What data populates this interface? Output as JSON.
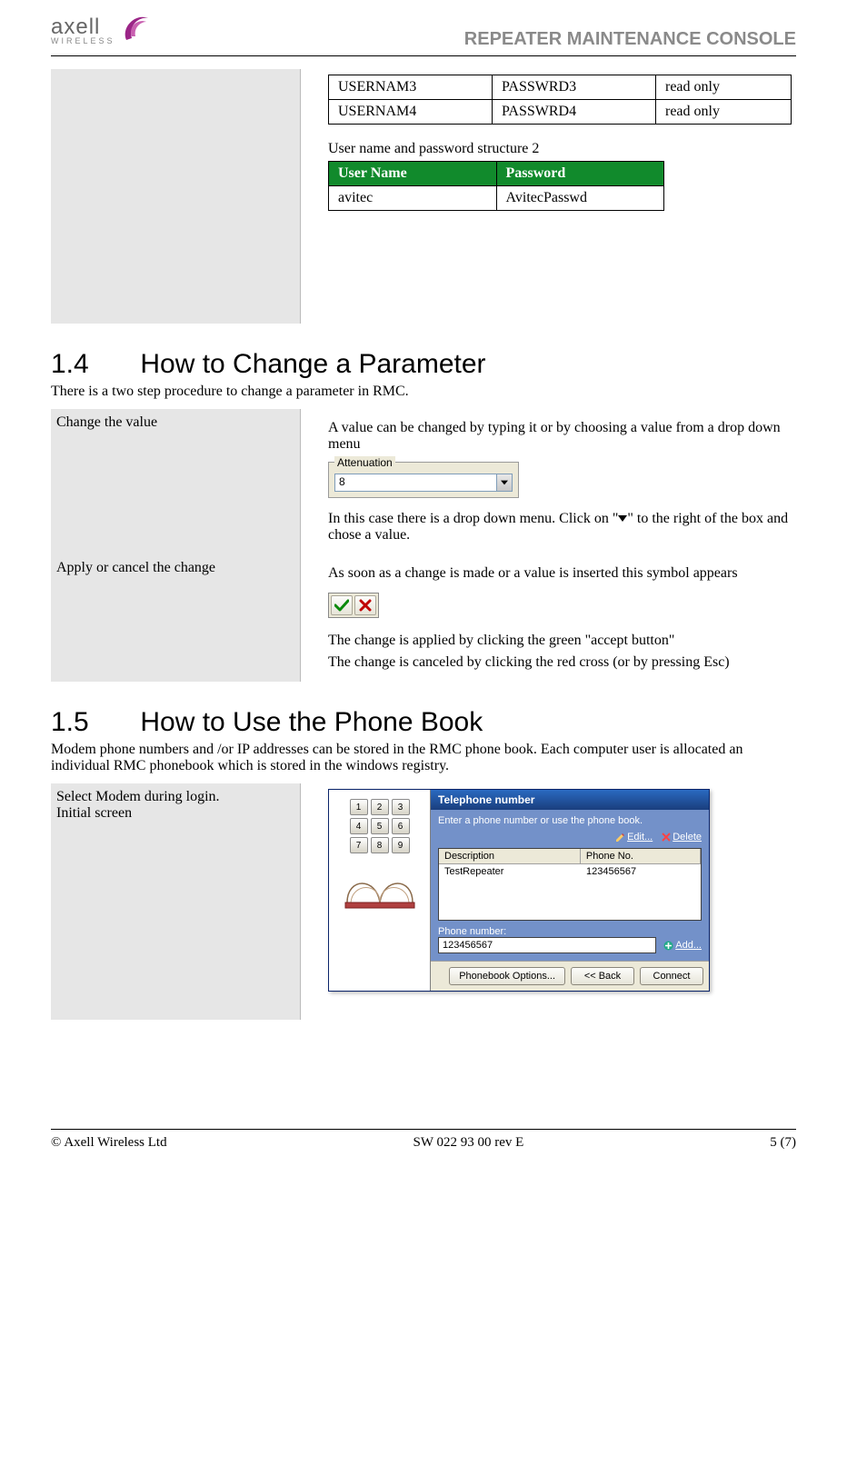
{
  "header": {
    "logo_main": "axell",
    "logo_sub": "WIRELESS",
    "title": "REPEATER MAINTENANCE CONSOLE"
  },
  "cred_table": {
    "rows": [
      {
        "user": "USERNAM3",
        "pass": "PASSWRD3",
        "perm": "read only"
      },
      {
        "user": "USERNAM4",
        "pass": "PASSWRD4",
        "perm": "read only"
      }
    ]
  },
  "struct2": {
    "caption": "User name and password structure 2",
    "head_user": "User Name",
    "head_pass": "Password",
    "row": {
      "user": "avitec",
      "pass": "AvitecPasswd"
    }
  },
  "sec14": {
    "num": "1.4",
    "title": "How to Change a Parameter",
    "intro": "There is a two step procedure to change a parameter in RMC.",
    "row1": {
      "left": "Change the value",
      "p1": "A value can be changed by typing it or by choosing a value from a drop down menu",
      "atten_label": "Attenuation",
      "atten_value": "8",
      "p2a": "In this case there is a drop down menu. Click on \"",
      "p2b": "\" to the right of the box and  chose a value."
    },
    "row2": {
      "left": "Apply or cancel the change",
      "p1": "As soon as a change is made or a value is inserted this symbol appears",
      "p2": "The change is applied by clicking the green \"accept button\"",
      "p3": "The change is canceled by clicking the red cross (or by pressing Esc)"
    }
  },
  "sec15": {
    "num": "1.5",
    "title": "How to Use the Phone Book",
    "intro": "Modem phone numbers and /or IP addresses can be stored in the RMC phone book.  Each computer user is allocated an individual RMC phonebook which is stored in the windows registry.",
    "left_line1": "Select Modem during login.",
    "left_line2": "Initial screen",
    "dialog": {
      "title": "Telephone number",
      "hint": "Enter a phone number or use the phone book.",
      "edit": "Edit...",
      "delete": "Delete",
      "col_desc": "Description",
      "col_phone": "Phone No.",
      "row_desc": "TestRepeater",
      "row_phone": "123456567",
      "phone_label": "Phone number:",
      "phone_value": "123456567",
      "add": "Add...",
      "btn_options": "Phonebook Options...",
      "btn_back": "<< Back",
      "btn_connect": "Connect",
      "keys": [
        "1",
        "2",
        "3",
        "4",
        "5",
        "6",
        "7",
        "8",
        "9"
      ]
    }
  },
  "footer": {
    "left": "© Axell Wireless Ltd",
    "center": "SW 022 93 00 rev E",
    "right": "5 (7)"
  }
}
